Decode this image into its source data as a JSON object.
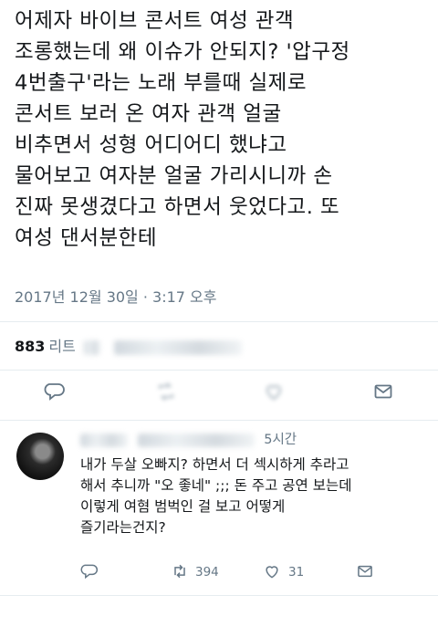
{
  "main_tweet": {
    "text_lines": [
      "어제자 바이브 콘서트 여성 관객",
      "조롱했는데 왜 이슈가 안되지? '압구정",
      "4번출구'라는 노래 부를때 실제로",
      "콘서트 보러 온 여자 관객 얼굴",
      "비추면서 성형 어디어디 했냐고",
      "물어보고 여자분 얼굴 가리시니까 손",
      "진짜 못생겼다고 하면서 웃었다고. 또",
      "여성 댄서분한테"
    ],
    "timestamp": "2017년 12월 30일 · 3:17 오후",
    "retweet_count": "883",
    "retweet_label": "리트",
    "actions": {
      "reply_icon": "reply-icon",
      "retweet_icon": "retweet-icon",
      "like_icon": "heart-icon",
      "share_icon": "mail-icon"
    }
  },
  "reply_tweet": {
    "time": "5시간",
    "text_lines": [
      "내가 두살 오빠지? 하면서 더 섹시하게 추라고",
      "해서 추니까 \"오 좋네\" ;;; 돈 주고 공연 보는데",
      "이렇게 여혐 범벅인 걸 보고 어떻게",
      "즐기라는건지?"
    ],
    "retweets": "394",
    "likes": "31"
  },
  "colors": {
    "text": "#14171a",
    "secondary": "#657786",
    "divider": "#e6ecf0",
    "icon": "#657786"
  }
}
